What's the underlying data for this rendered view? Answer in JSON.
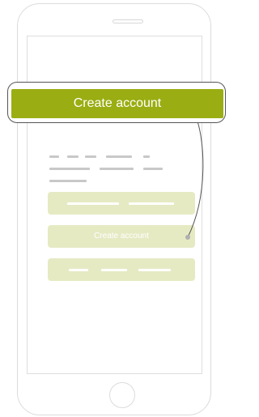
{
  "callout": {
    "label": "Create account"
  },
  "screen": {
    "buttons": [
      {
        "label": ""
      },
      {
        "label": "Create account"
      },
      {
        "label": ""
      }
    ]
  },
  "colors": {
    "accent": "#9aad12",
    "accent_light": "#e6eac3",
    "outline": "#555555",
    "device_stroke": "#dcdcdc",
    "placeholder": "#c8c8c8"
  }
}
